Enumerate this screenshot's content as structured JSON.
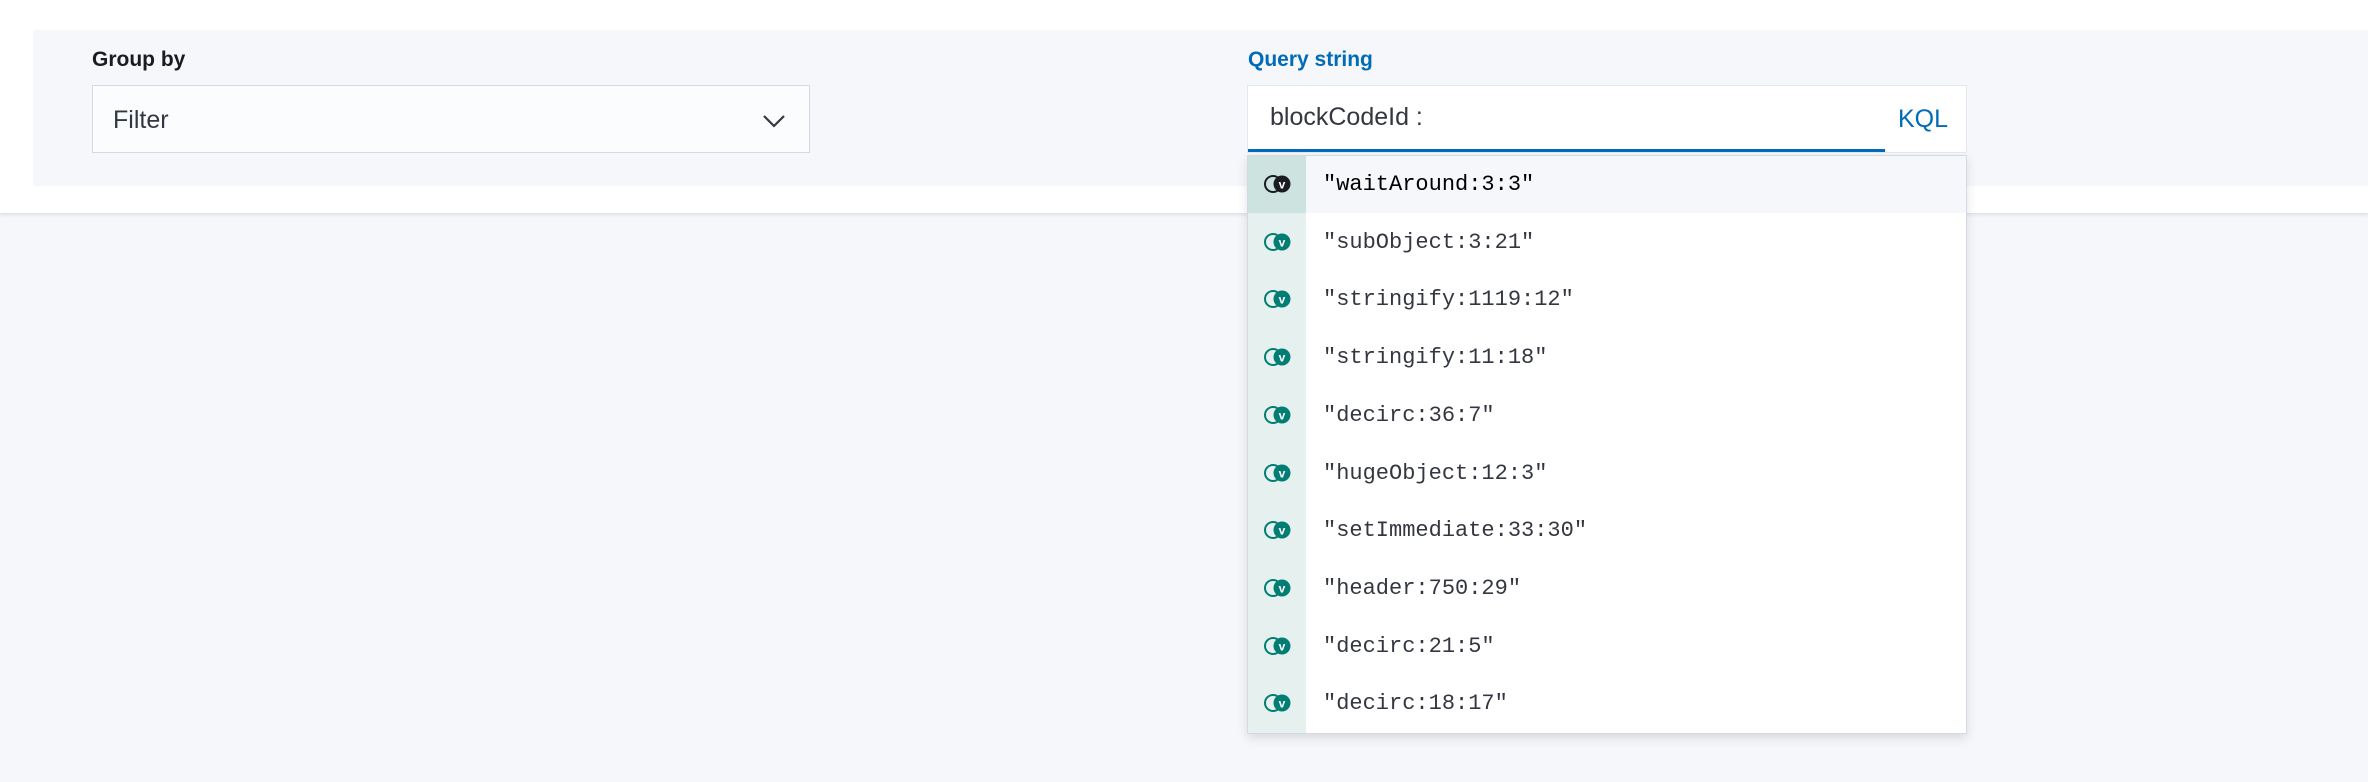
{
  "group_by": {
    "label": "Group by",
    "selected": "Filter"
  },
  "query": {
    "label": "Query string",
    "value": "blockCodeId : ",
    "language_toggle": "KQL"
  },
  "suggestions": [
    {
      "text": "\"waitAround:3:3\"",
      "icon": "value-icon",
      "selected": true
    },
    {
      "text": "\"subObject:3:21\"",
      "icon": "value-icon",
      "selected": false
    },
    {
      "text": "\"stringify:1119:12\"",
      "icon": "value-icon",
      "selected": false
    },
    {
      "text": "\"stringify:11:18\"",
      "icon": "value-icon",
      "selected": false
    },
    {
      "text": "\"decirc:36:7\"",
      "icon": "value-icon",
      "selected": false
    },
    {
      "text": "\"hugeObject:12:3\"",
      "icon": "value-icon",
      "selected": false
    },
    {
      "text": "\"setImmediate:33:30\"",
      "icon": "value-icon",
      "selected": false
    },
    {
      "text": "\"header:750:29\"",
      "icon": "value-icon",
      "selected": false
    },
    {
      "text": "\"decirc:21:5\"",
      "icon": "value-icon",
      "selected": false
    },
    {
      "text": "\"decirc:18:17\"",
      "icon": "value-icon",
      "selected": false
    }
  ],
  "icon_glyph": "v",
  "colors": {
    "accent": "#006bb8",
    "value_icon": "#017d73",
    "value_icon_selected": "#1a1c21"
  }
}
